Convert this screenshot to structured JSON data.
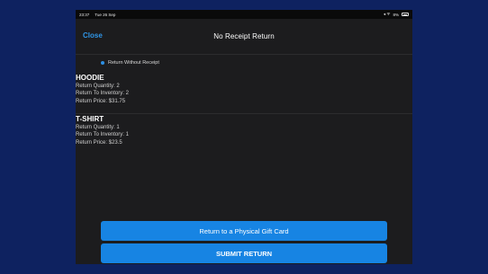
{
  "status_bar": {
    "time": "23:37",
    "date": "Tue 26 Sep",
    "indicators": "◂ ᯤ",
    "battery_percent": "8%"
  },
  "nav": {
    "close_label": "Close",
    "title": "No Receipt Return"
  },
  "return_option": {
    "label": "Return Without Receipt",
    "selected": true
  },
  "items": [
    {
      "name": "HOODIE",
      "quantity_label": "Return Quantity: 2",
      "inventory_label": "Return To Inventory: 2",
      "price_label": "Return Price: $31.75"
    },
    {
      "name": "T-SHIRT",
      "quantity_label": "Return Quantity: 1",
      "inventory_label": "Return To Inventory: 1",
      "price_label": "Return Price: $23.5"
    }
  ],
  "actions": {
    "gift_card_label": "Return to a Physical Gift Card",
    "submit_label": "SUBMIT RETURN"
  },
  "colors": {
    "background": "#0e2260",
    "panel": "#1c1c1e",
    "accent": "#1784e3",
    "link": "#2f95e6"
  }
}
